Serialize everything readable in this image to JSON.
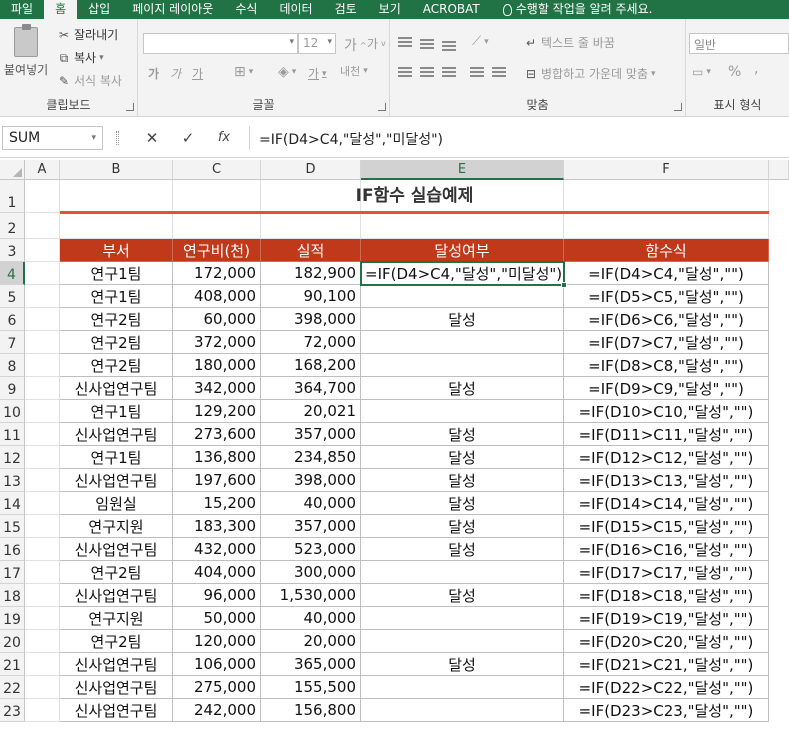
{
  "ribbon": {
    "tabs": [
      "파일",
      "홈",
      "삽입",
      "페이지 레이아웃",
      "수식",
      "데이터",
      "검토",
      "보기",
      "ACROBAT"
    ],
    "active_tab": "홈",
    "tell_me": "수행할 작업을 알려 주세요.",
    "clipboard": {
      "label": "클립보드",
      "paste": "붙여넣기",
      "cut": "잘라내기",
      "copy": "복사",
      "format_painter": "서식 복사"
    },
    "font": {
      "label": "글꼴",
      "size": "12",
      "bold": "가",
      "italic": "가",
      "underline": "가",
      "phonetic": "내천"
    },
    "alignment": {
      "label": "맞춤",
      "wrap_text": "텍스트 줄 바꿈",
      "merge_center": "병합하고 가운데 맞춤"
    },
    "number": {
      "label": "표시 형식",
      "format": "일반",
      "percent": "%"
    }
  },
  "formula_bar": {
    "name_box": "SUM",
    "cancel": "✕",
    "enter": "✓",
    "fx": "fx",
    "formula": "=IF(D4>C4,\"달성\",\"미달성\")"
  },
  "sheet": {
    "columns": [
      "A",
      "B",
      "C",
      "D",
      "E",
      "F"
    ],
    "title": "IF함수 실습예제",
    "headers": [
      "부서",
      "연구비(천)",
      "실적",
      "달성여부",
      "함수식"
    ],
    "active_cell": "E4",
    "rows": [
      [
        "연구1팀",
        "172,000",
        "182,900",
        "=IF(D4>C4,\"달성\",\"미달성\")",
        "=IF(D4>C4,\"달성\",\"\")"
      ],
      [
        "연구1팀",
        "408,000",
        "90,100",
        "",
        "=IF(D5>C5,\"달성\",\"\")"
      ],
      [
        "연구2팀",
        "60,000",
        "398,000",
        "달성",
        "=IF(D6>C6,\"달성\",\"\")"
      ],
      [
        "연구2팀",
        "372,000",
        "72,000",
        "",
        "=IF(D7>C7,\"달성\",\"\")"
      ],
      [
        "연구2팀",
        "180,000",
        "168,200",
        "",
        "=IF(D8>C8,\"달성\",\"\")"
      ],
      [
        "신사업연구팀",
        "342,000",
        "364,700",
        "달성",
        "=IF(D9>C9,\"달성\",\"\")"
      ],
      [
        "연구1팀",
        "129,200",
        "20,021",
        "",
        "=IF(D10>C10,\"달성\",\"\")"
      ],
      [
        "신사업연구팀",
        "273,600",
        "357,000",
        "달성",
        "=IF(D11>C11,\"달성\",\"\")"
      ],
      [
        "연구1팀",
        "136,800",
        "234,850",
        "달성",
        "=IF(D12>C12,\"달성\",\"\")"
      ],
      [
        "신사업연구팀",
        "197,600",
        "398,000",
        "달성",
        "=IF(D13>C13,\"달성\",\"\")"
      ],
      [
        "임원실",
        "15,200",
        "40,000",
        "달성",
        "=IF(D14>C14,\"달성\",\"\")"
      ],
      [
        "연구지원",
        "183,300",
        "357,000",
        "달성",
        "=IF(D15>C15,\"달성\",\"\")"
      ],
      [
        "신사업연구팀",
        "432,000",
        "523,000",
        "달성",
        "=IF(D16>C16,\"달성\",\"\")"
      ],
      [
        "연구2팀",
        "404,000",
        "300,000",
        "",
        "=IF(D17>C17,\"달성\",\"\")"
      ],
      [
        "신사업연구팀",
        "96,000",
        "1,530,000",
        "달성",
        "=IF(D18>C18,\"달성\",\"\")"
      ],
      [
        "연구지원",
        "50,000",
        "40,000",
        "",
        "=IF(D19>C19,\"달성\",\"\")"
      ],
      [
        "연구2팀",
        "120,000",
        "20,000",
        "",
        "=IF(D20>C20,\"달성\",\"\")"
      ],
      [
        "신사업연구팀",
        "106,000",
        "365,000",
        "달성",
        "=IF(D21>C21,\"달성\",\"\")"
      ],
      [
        "신사업연구팀",
        "275,000",
        "155,500",
        "",
        "=IF(D22>C22,\"달성\",\"\")"
      ],
      [
        "신사업연구팀",
        "242,000",
        "156,800",
        "",
        "=IF(D23>C23,\"달성\",\"\")"
      ]
    ],
    "colors": {
      "header_fill": "#c0391b",
      "title_rule": "#e0542f",
      "accent": "#217346"
    }
  }
}
